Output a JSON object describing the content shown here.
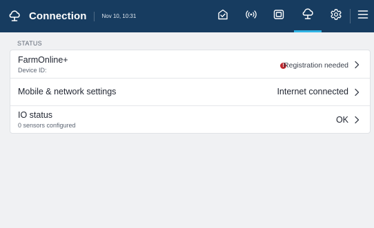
{
  "header": {
    "title": "Connection",
    "datetime": "Nov 10, 10:31",
    "icons": [
      "cloud-icon",
      "dashboard-check-icon",
      "broadcast-icon",
      "device-screen-icon",
      "cloud-icon",
      "gear-icon",
      "menu-icon"
    ],
    "active_icon": "cloud-icon"
  },
  "status": {
    "section_label": "STATUS",
    "rows": [
      {
        "title": "FarmOnline+",
        "subtitle": "Device ID:",
        "value": "Registration needed",
        "value_status": "error"
      },
      {
        "title": "Mobile & network settings",
        "value": "Internet connected"
      },
      {
        "title": "IO status",
        "subtitle": "0 sensors configured",
        "value": "OK"
      }
    ]
  },
  "colors": {
    "header_bg": "#173c60",
    "accent": "#2fb3e4",
    "error": "#c0282f",
    "page_bg": "#f0f1f3"
  }
}
